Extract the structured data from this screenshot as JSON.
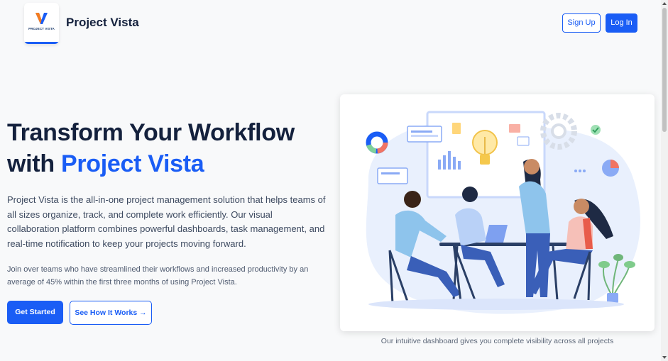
{
  "header": {
    "brand": "Project Vista",
    "logo_text": "PROJECT VISTA",
    "logo_icon": "v-logo-icon",
    "signup_label": "Sign Up",
    "login_label": "Log In"
  },
  "hero": {
    "title_line1": "Transform Your Workflow",
    "title_prefix": "with",
    "title_accent": "Project Vista",
    "description": "Project Vista is the all-in-one project management solution that helps teams of all sizes organize, track, and complete work efficiently. Our visual collaboration platform combines powerful dashboards, task management, and real-time notification to keep your projects moving forward.",
    "subtext": "Join over teams who have streamlined their workflows and increased productivity by an average of 45% within the first three months of using Project Vista.",
    "primary_cta": "Get Started",
    "secondary_cta": "See How It Works →"
  },
  "illustration": {
    "caption": "Our intuitive dashboard gives you complete visibility across all projects"
  },
  "colors": {
    "accent": "#1a5df5",
    "heading": "#14213d",
    "background": "#f8f9fa"
  }
}
